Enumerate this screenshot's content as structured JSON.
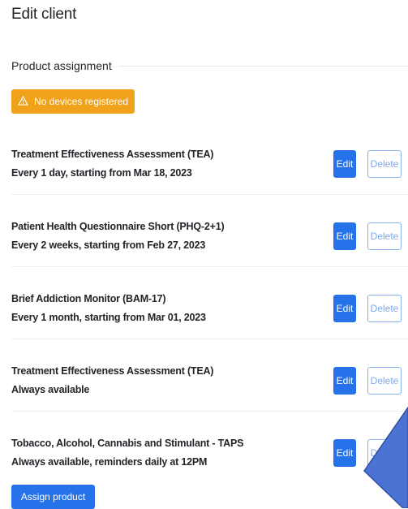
{
  "page": {
    "title": "Edit client"
  },
  "section": {
    "title": "Product assignment"
  },
  "warning": {
    "text": "No devices registered",
    "icon": "warning-triangle-icon",
    "color": "#f0a31a"
  },
  "products": [
    {
      "name": "Treatment Effectiveness Assessment (TEA)",
      "schedule": "Every 1 day, starting from Mar 18, 2023",
      "edit_label": "Edit",
      "delete_label": "Delete"
    },
    {
      "name": "Patient Health Questionnaire Short (PHQ-2+1)",
      "schedule": "Every 2 weeks, starting from Feb 27, 2023",
      "edit_label": "Edit",
      "delete_label": "Delete"
    },
    {
      "name": "Brief Addiction Monitor (BAM-17)",
      "schedule": "Every 1 month, starting from Mar 01, 2023",
      "edit_label": "Edit",
      "delete_label": "Delete"
    },
    {
      "name": "Treatment Effectiveness Assessment (TEA)",
      "schedule": "Always available",
      "edit_label": "Edit",
      "delete_label": "Delete"
    },
    {
      "name": "Tobacco, Alcohol, Cannabis and Stimulant - TAPS",
      "schedule": "Always available, reminders daily at 12PM",
      "edit_label": "Edit",
      "delete_label": "Delete"
    }
  ],
  "assign_button": {
    "label": "Assign product"
  },
  "colors": {
    "primary": "#2572ea",
    "outline": "#8db0ee",
    "pointer": "#4a73d4"
  }
}
